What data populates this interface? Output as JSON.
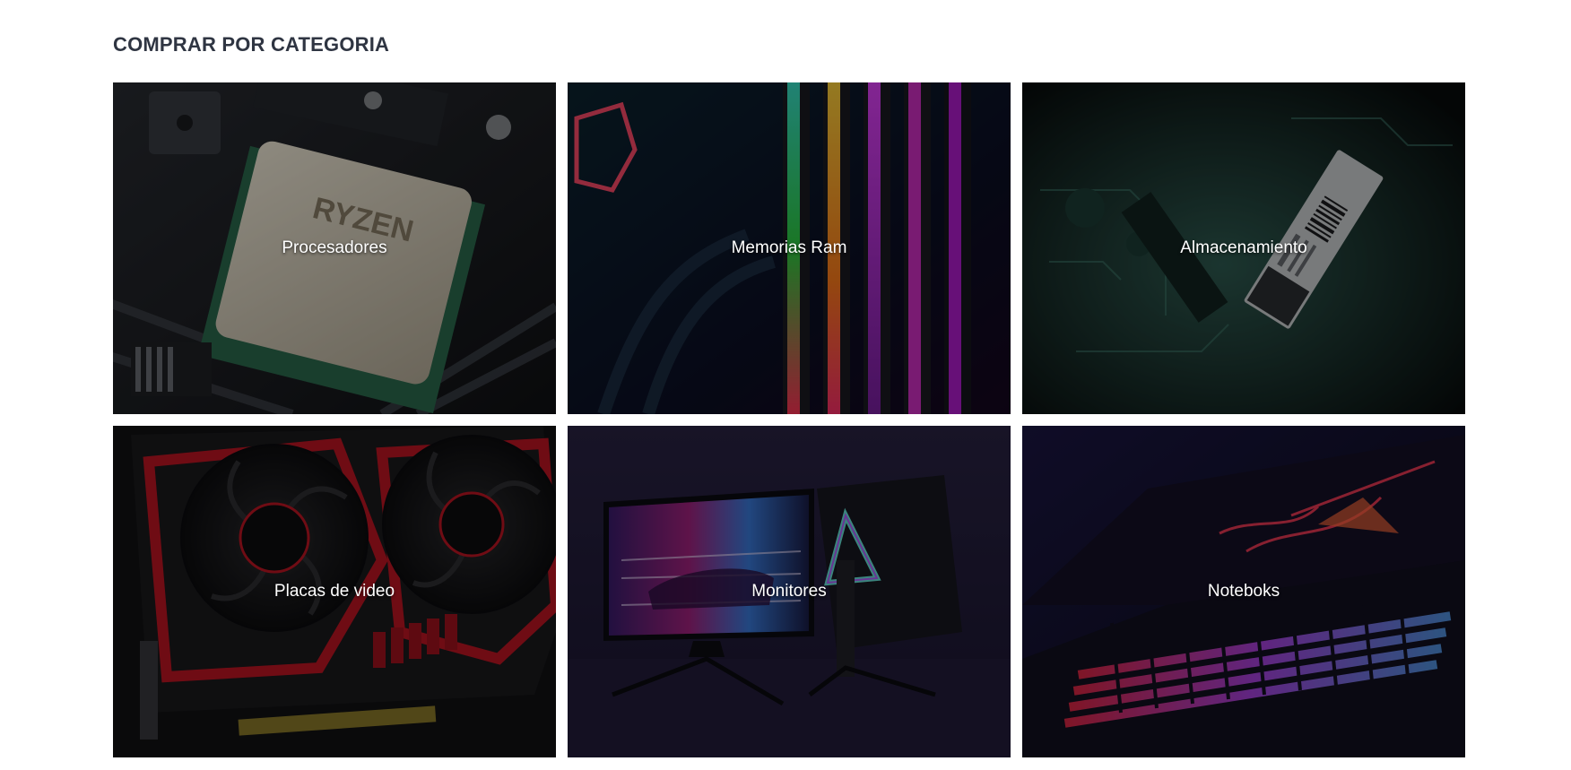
{
  "section": {
    "title": "COMPRAR POR CATEGORIA"
  },
  "categories": [
    {
      "label": "Procesadores",
      "image": "cpu-chip-image",
      "accent": "#d8d0bd"
    },
    {
      "label": "Memorias Ram",
      "image": "rgb-ram-image",
      "accent": "#c93bd6"
    },
    {
      "label": "Almacenamiento",
      "image": "ssd-m2-image",
      "accent": "#2f6a5e"
    },
    {
      "label": "Placas de video",
      "image": "graphics-card-image",
      "accent": "#c0182a"
    },
    {
      "label": "Monitores",
      "image": "monitor-image",
      "accent": "#7a4fd0"
    },
    {
      "label": "Noteboks",
      "image": "notebook-image",
      "accent": "#e0365a"
    }
  ]
}
